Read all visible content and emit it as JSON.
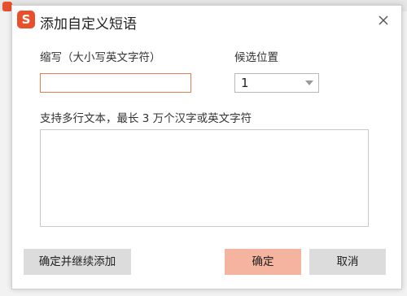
{
  "background_window": {
    "logo_color": "#e8502c"
  },
  "dialog": {
    "title": "添加自定义短语",
    "logo_text": "S",
    "logo_color": "#e8502c",
    "close_icon": "close-icon"
  },
  "form": {
    "abbreviation_label": "缩写（大小写英文字符）",
    "abbreviation_value": "",
    "candidate_position_label": "候选位置",
    "candidate_position_value": "1",
    "content_label": "支持多行文本，最长 3 万个汉字或英文字符",
    "content_value": ""
  },
  "buttons": {
    "confirm_and_continue": "确定并继续添加",
    "confirm": "确定",
    "cancel": "取消"
  },
  "colors": {
    "accent_border": "#e28052",
    "primary_button": "#f4b4a0",
    "secondary_button": "#dcdcdc"
  }
}
